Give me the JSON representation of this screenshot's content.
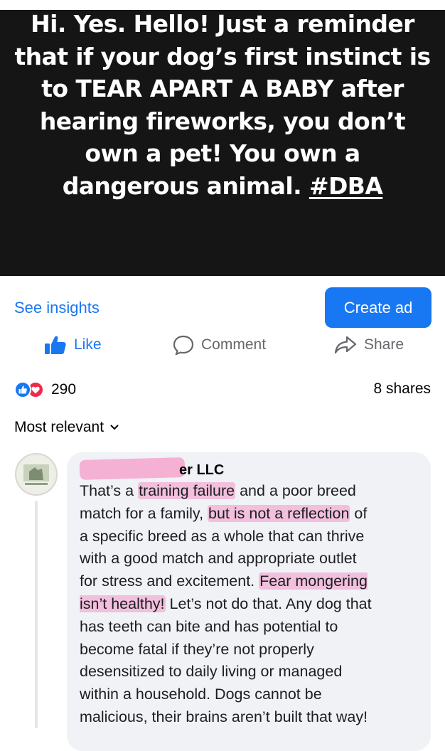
{
  "post": {
    "image_text": "Hi. Yes. Hello! Just a reminder that if your dog’s first instinct is to TEAR APART A BABY after hearing fireworks, you don’t own a pet! You own a dangerous animal.",
    "hashtag": "#DBA"
  },
  "toolbar": {
    "insights_label": "See insights",
    "create_ad_label": "Create ad"
  },
  "actions": {
    "like_label": "Like",
    "comment_label": "Comment",
    "share_label": "Share"
  },
  "engagement": {
    "reaction_count": "290",
    "shares_label": "8 shares"
  },
  "comments": {
    "sort_label": "Most relevant",
    "items": [
      {
        "author": "er LLC",
        "text_parts": [
          "That’s a ",
          "training failure",
          " and a poor breed\nmatch for a family, ",
          "but is not a reflection",
          " of\na specific breed as a whole that can thrive\nwith a good match and appropriate outlet\nfor stress and excitement. ",
          "Fear mongering\nisn’t healthy!",
          " Let’s not do that. Any dog that\nhas teeth can bite and has potential to\nbecome fatal if they’re not properly\ndesensitized to daily living or managed\nwithin a household. Dogs cannot be\nmalicious, their brains aren’t built that way!"
        ]
      }
    ]
  },
  "colors": {
    "accent": "#1877f2",
    "love": "#f02849",
    "highlight": "#f5b1d3",
    "bubble": "#f0f2f5",
    "image_bg": "#151515"
  }
}
